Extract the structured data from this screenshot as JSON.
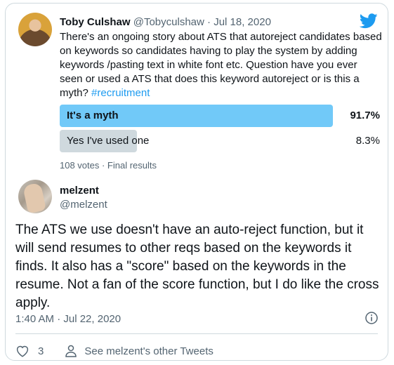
{
  "quoted": {
    "name": "Toby Culshaw",
    "handle": "@Tobyculshaw",
    "separator": "·",
    "date": "Jul 18, 2020",
    "text": "There's an ongoing story about ATS that autoreject candidates based on keywords so candidates having to play the system by adding keywords /pasting text in white font etc. Question have you ever seen or used a ATS that does this keyword autoreject or is this a myth?",
    "hashtag": "#recruitment"
  },
  "poll": {
    "options": [
      {
        "label": "It's a myth",
        "percent_text": "91.7%",
        "fraction": 0.917
      },
      {
        "label": "Yes I've used one",
        "percent_text": "8.3%",
        "fraction": 0.083
      }
    ],
    "meta": "108 votes · Final results"
  },
  "tweet": {
    "name": "melzent",
    "handle": "@melzent",
    "text": "The ATS we use doesn't have an auto-reject function, but it will send resumes to other reqs based on the keywords it finds.  It also has a \"score\" based on the keywords in the resume.  Not a fan of the score function, but I do like the cross apply.",
    "timestamp": "1:40 AM · Jul 22, 2020"
  },
  "actions": {
    "like_count": "3",
    "see_other": "See melzent's other Tweets"
  },
  "colors": {
    "accent": "#1d9bf0",
    "poll_winner": "#71c9f8",
    "poll_other": "#cfd9de",
    "secondary_text": "#536471"
  },
  "icons": [
    "twitter-bird-icon",
    "info-icon",
    "heart-icon",
    "person-icon"
  ]
}
